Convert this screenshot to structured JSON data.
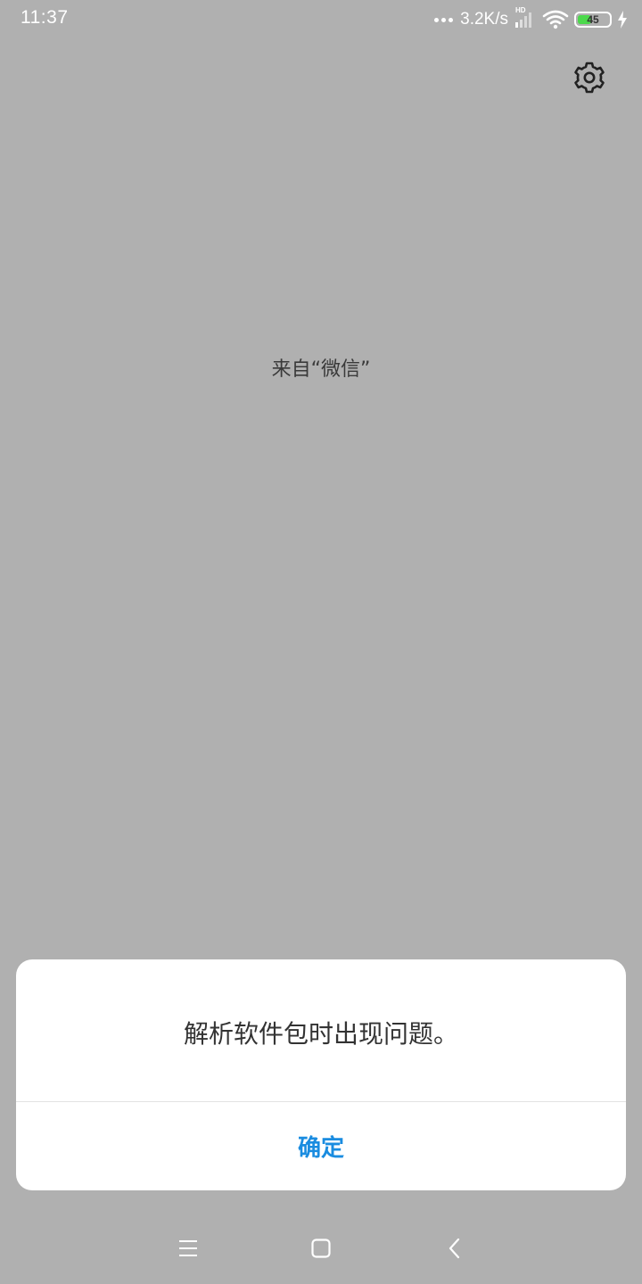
{
  "status_bar": {
    "time": "11:37",
    "net_speed": "3.2K/s",
    "signal_label": "HD",
    "battery_level": "45",
    "battery_fill": 0.45,
    "colors": {
      "battery_fill": "#4cd94c"
    }
  },
  "icons": {
    "settings": "gear-icon",
    "menu": "menu-icon",
    "home": "home-icon",
    "back": "back-icon"
  },
  "source_text": "来自“微信”",
  "dialog": {
    "message": "解析软件包时出现问题。",
    "confirm_label": "确定",
    "colors": {
      "confirm": "#1a8ce0"
    }
  }
}
